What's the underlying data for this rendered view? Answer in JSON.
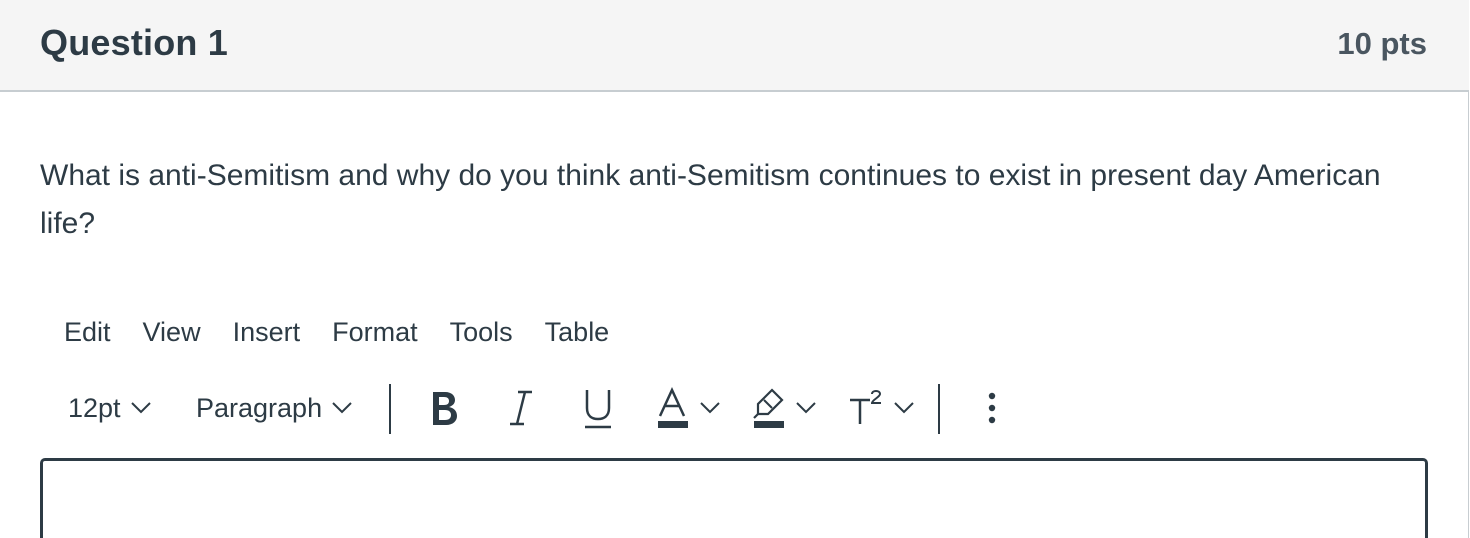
{
  "question": {
    "title": "Question 1",
    "points": "10 pts",
    "text": "What is anti-Semitism and why do you think anti-Semitism continues to exist in present day American life?"
  },
  "editor": {
    "menu": [
      "Edit",
      "View",
      "Insert",
      "Format",
      "Tools",
      "Table"
    ],
    "toolbar": {
      "font_size": "12pt",
      "block_format": "Paragraph",
      "bold_icon": "bold-icon",
      "italic_icon": "italic-icon",
      "underline_icon": "underline-icon",
      "text_color_icon": "text-color-icon",
      "highlight_icon": "highlight-icon",
      "superscript_icon": "superscript-icon",
      "more_icon": "more-vertical-icon"
    },
    "colors": {
      "text": "#2d3b45",
      "header_bg": "#f5f5f5",
      "border": "#c7cdd1"
    }
  }
}
